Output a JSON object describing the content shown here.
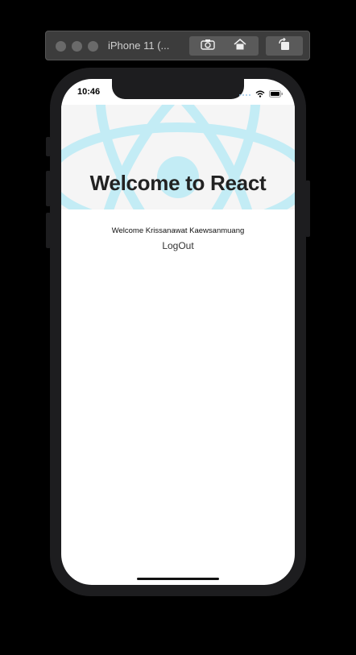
{
  "simulator": {
    "title": "iPhone 11 (..."
  },
  "status_bar": {
    "time": "10:46"
  },
  "header": {
    "title": "Welcome to React"
  },
  "main": {
    "welcome_text": "Welcome Krissanawat Kaewsanmuang",
    "logout_label": "LogOut"
  },
  "icons": {
    "screenshot": "camera-icon",
    "home": "home-icon",
    "rotate": "rotate-icon",
    "wifi": "wifi-icon",
    "battery": "battery-icon",
    "cellular": "cellular-icon",
    "logo": "react-logo"
  },
  "colors": {
    "react_logo": "#c3ecf5",
    "header_bg": "#f5f5f5",
    "title_text": "#222222"
  }
}
